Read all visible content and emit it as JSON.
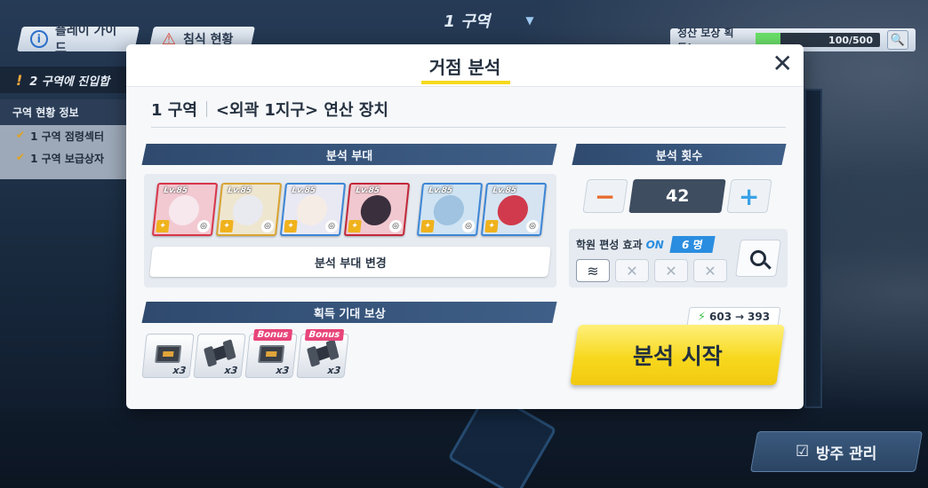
{
  "hud": {
    "zone_title": "1 구역",
    "play_guide": "플레이 가이드",
    "erosion_status": "침식 현황",
    "reward_label": "정산 보상 획득!",
    "reward_progress_text": "100/500",
    "reward_progress": 0.2,
    "notice_text": "2 구역에 진입합",
    "status_panel_title": "구역 현황 정보",
    "status_rows": [
      "1 구역 점령섹터",
      "1 구역 보급상자"
    ],
    "defense_button": "방주 관리"
  },
  "modal": {
    "title": "거점 분석",
    "zone": "1 구역",
    "location": "<외곽 1지구> 연산 장치",
    "squad_header": "분석 부대",
    "count_header": "분석 횟수",
    "reward_header": "획득 기대 보상",
    "change_squad_label": "분석 부대 변경",
    "analysis_count": "42",
    "minus_label": "−",
    "plus_label": "+",
    "effect_label": "학원 편성 효과",
    "effect_state": "ON",
    "effect_count": "6 명",
    "start_label": "분석 시작",
    "cost_from": "603",
    "cost_arrow": "→",
    "cost_to": "393",
    "close_label": "✕"
  },
  "squad": [
    {
      "level": "Lv.85",
      "bg": "#f2c9d1",
      "frame": "#d9364a",
      "face": "#f7e8ee"
    },
    {
      "level": "Lv.85",
      "bg": "#efe6d0",
      "frame": "#d8a432",
      "face": "#e9eaf0"
    },
    {
      "level": "Lv.85",
      "bg": "#e9e9f3",
      "frame": "#3d86d6",
      "face": "#f6ece6"
    },
    {
      "level": "Lv.85",
      "bg": "#f1c8cf",
      "frame": "#c2283a",
      "face": "#3a2f3d"
    },
    {
      "level": "Lv.85",
      "bg": "#cfe3f3",
      "frame": "#3d86d6",
      "face": "#9fc3e0"
    },
    {
      "level": "Lv.85",
      "bg": "#d6e4f2",
      "frame": "#3d86d6",
      "face": "#d03a4c"
    }
  ],
  "rewards": [
    {
      "type": "chip",
      "qty": "x3",
      "bonus": ""
    },
    {
      "type": "bolt",
      "qty": "x3",
      "bonus": ""
    },
    {
      "type": "chip",
      "qty": "x3",
      "bonus": "Bonus"
    },
    {
      "type": "bolt",
      "qty": "x3",
      "bonus": "Bonus"
    }
  ],
  "colors": {
    "accent_yellow": "#f7d81e",
    "header_navy": "#2f4a6e",
    "on_blue": "#2a8de0",
    "minus_orange": "#e86a2a",
    "plus_blue": "#3aa2e6"
  }
}
